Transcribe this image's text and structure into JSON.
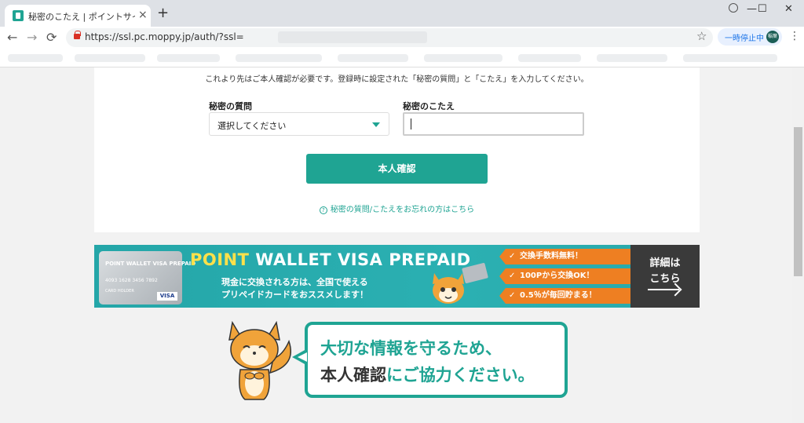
{
  "browser": {
    "tab_title": "秘密のこたえ | ポイントサイトでお小遣",
    "tab_close": "×",
    "new_tab": "+",
    "window_controls": {
      "minimize": "—",
      "maximize": "☐",
      "close": "✕"
    },
    "nav": {
      "back": "←",
      "forward": "→",
      "reload": "⟳"
    },
    "url": "https://ssl.pc.moppy.jp/auth/?ssl=",
    "star": "☆",
    "sync_status": "一時停止中",
    "avatar_text": "稲葉",
    "menu": "⋮"
  },
  "auth": {
    "intro": "これより先はご本人確認が必要です。登録時に設定された「秘密の質問」と「こたえ」を入力してください。",
    "question_label": "秘密の質問",
    "question_selected": "選択してください",
    "answer_label": "秘密のこたえ",
    "answer_value": "",
    "confirm_button": "本人確認",
    "forgot_icon": "?",
    "forgot_link": "秘密の質問/こたえをお忘れの方はこちら"
  },
  "banner": {
    "card_brand": "POINT WALLET VISA PREPAID",
    "card_number": "4093 1628 3456 7892",
    "card_holder": "CARD HOLDER",
    "card_visa": "VISA",
    "title_accent": "POINT",
    "title_rest": " WALLET VISA PREPAID",
    "sub_line1": "現金に交換される方は、全国で使える",
    "sub_line2": "プリペイドカードをおススメします！",
    "features": [
      {
        "check": "✓",
        "text": "交換手数料無料！"
      },
      {
        "check": "✓",
        "text": "100Pから交換OK！"
      },
      {
        "check": "✓",
        "text": "0.5％が毎回貯まる！"
      }
    ],
    "detail_line1": "詳細は",
    "detail_line2": "こちら"
  },
  "message": {
    "line1": "大切な情報を守るため、",
    "line2_dark": "本人確認",
    "line2_rest": "にご協力ください。"
  },
  "colors": {
    "brand": "#1fa493",
    "banner_orange": "#ee7f22",
    "banner_title_accent": "#ffe14a",
    "mascot_orange": "#f0a33a"
  }
}
